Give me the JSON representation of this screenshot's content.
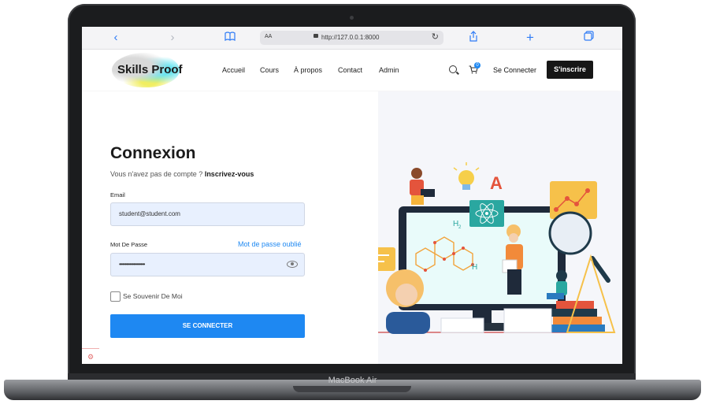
{
  "device": {
    "label": "MacBook Air"
  },
  "browser": {
    "url": "http://127.0.0.1:8000",
    "aa": "AA",
    "icons": [
      "back-icon",
      "forward-icon",
      "book-icon",
      "share-icon",
      "new-tab-icon",
      "tabs-icon",
      "reload-icon",
      "lock-icon"
    ]
  },
  "navbar": {
    "logo": "Skills Proof",
    "links": [
      "Accueil",
      "Cours",
      "À propos",
      "Contact",
      "Admin"
    ],
    "cart_count": "0",
    "login": "Se Connecter",
    "signup": "S'inscrire"
  },
  "login": {
    "title": "Connexion",
    "subtitle_prefix": "Vous n'avez pas de compte ?",
    "subtitle_link": "Inscrivez-vous",
    "email_label": "Email",
    "email_value": "student@student.com",
    "password_label": "Mot De Passe",
    "forgot": "Mot de passe oublié",
    "password_value": "••••••••••••••••••",
    "remember": "Se Souvenir De Moi",
    "submit": "SE CONNECTER"
  },
  "colors": {
    "accent": "#1e88f2",
    "dark": "#161616",
    "input_bg": "#e8f0fe",
    "illustration_bg": "#f5f6fa"
  },
  "illustration": {
    "labels": [
      "A",
      "H2",
      "H"
    ]
  }
}
